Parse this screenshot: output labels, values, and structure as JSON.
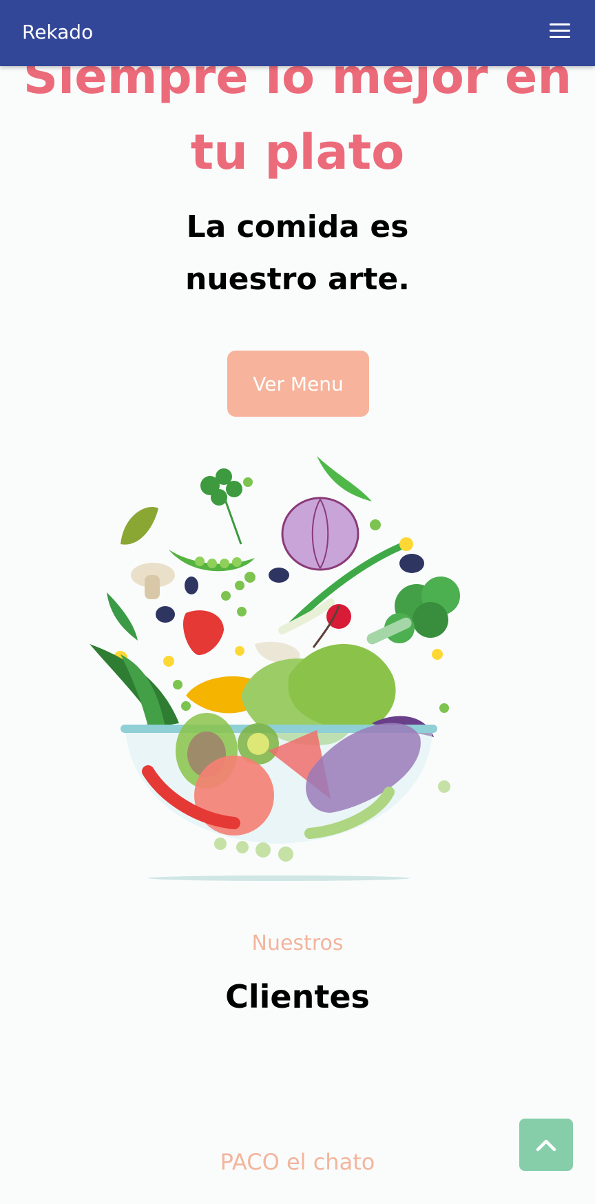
{
  "navbar": {
    "brand": "Rekado",
    "menu_icon": "hamburger-menu-icon"
  },
  "hero": {
    "title_line1": "Siempre lo mejor en",
    "title_line2": "tu plato",
    "subtitle_line1": "La comida es",
    "subtitle_line2": "nuestro arte.",
    "button_label": "Ver Menu",
    "illustration": "salad-bowl-vegetables-illustration"
  },
  "clients": {
    "kicker": "Nuestros",
    "title": "Clientes",
    "items": [
      {
        "name": "PACO el chato"
      }
    ]
  },
  "back_to_top": {
    "icon": "chevron-up-icon"
  },
  "colors": {
    "navbar": "#334799",
    "accent_pink": "#ec6b7a",
    "accent_peach": "#f7b39b",
    "back_to_top": "#86ceaa"
  }
}
